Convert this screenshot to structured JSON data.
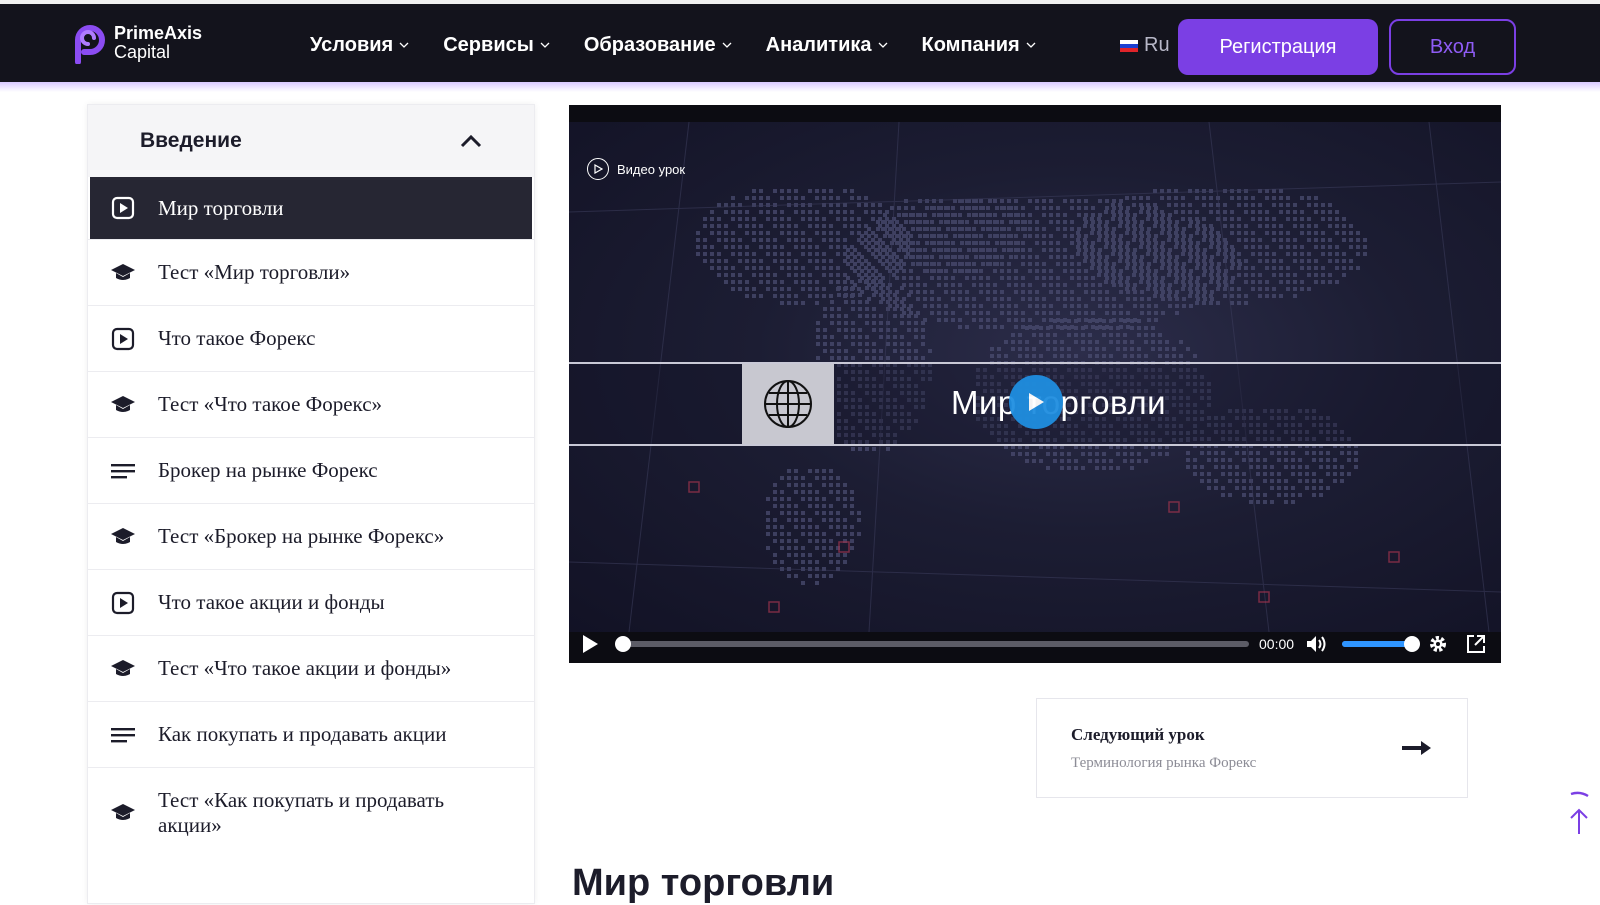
{
  "brand": {
    "line1": "PrimeAxis",
    "line2": "Capital",
    "accent": "#7b3fe4"
  },
  "nav": {
    "items": [
      {
        "label": "Условия"
      },
      {
        "label": "Сервисы"
      },
      {
        "label": "Образование"
      },
      {
        "label": "Аналитика"
      },
      {
        "label": "Компания"
      }
    ],
    "lang": "Ru",
    "register_label": "Регистрация",
    "login_label": "Вход"
  },
  "sidebar": {
    "title": "Введение",
    "items": [
      {
        "label": "Мир торговли",
        "icon": "play-square-icon",
        "active": true
      },
      {
        "label": "Тест «Мир торговли»",
        "icon": "graduation-cap-icon"
      },
      {
        "label": "Что такое Форекс",
        "icon": "play-square-icon"
      },
      {
        "label": "Тест «Что такое Форекс»",
        "icon": "graduation-cap-icon"
      },
      {
        "label": "Брокер на рынке Форекс",
        "icon": "text-lines-icon"
      },
      {
        "label": "Тест «Брокер на рынке Форекс»",
        "icon": "graduation-cap-icon"
      },
      {
        "label": "Что такое акции и фонды",
        "icon": "play-square-icon"
      },
      {
        "label": "Тест «Что такое акции и фонды»",
        "icon": "graduation-cap-icon"
      },
      {
        "label": "Как покупать и продавать акции",
        "icon": "text-lines-icon"
      },
      {
        "label": "Тест «Как покупать и продавать акции»",
        "icon": "graduation-cap-icon"
      }
    ]
  },
  "video": {
    "badge": "Видео урок",
    "title": "Мир торговли",
    "time": "00:00",
    "progress": 0,
    "volume": 1
  },
  "next_lesson": {
    "label": "Следующий урок",
    "title": "Терминология рынка Форекс"
  },
  "page_heading": "Мир торговли"
}
